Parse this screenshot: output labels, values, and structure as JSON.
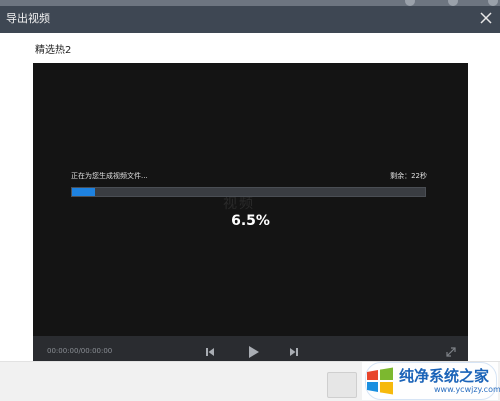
{
  "window": {
    "title": "导出视频",
    "close_icon": "close-icon"
  },
  "export": {
    "file_name": "精选热2",
    "status_text": "正在为您生成视频文件...",
    "remaining_text": "剩余：22秒",
    "progress_percent_label": "6.5%",
    "progress_fraction": 0.065,
    "watermark_text": "视频"
  },
  "player": {
    "time_display": "00:00:00/00:00:00",
    "icons": {
      "prev": "skip-back-icon",
      "play": "play-icon",
      "next": "skip-forward-icon",
      "fullscreen": "fullscreen-icon"
    }
  },
  "branding": {
    "site_name": "纯净系统之家",
    "site_url": "www.ycwjzy.com"
  },
  "colors": {
    "titlebar": "#3e4753",
    "progress_fill": "#1e82e0",
    "player_bg": "#141414",
    "brand_blue": "#1a63b8"
  }
}
